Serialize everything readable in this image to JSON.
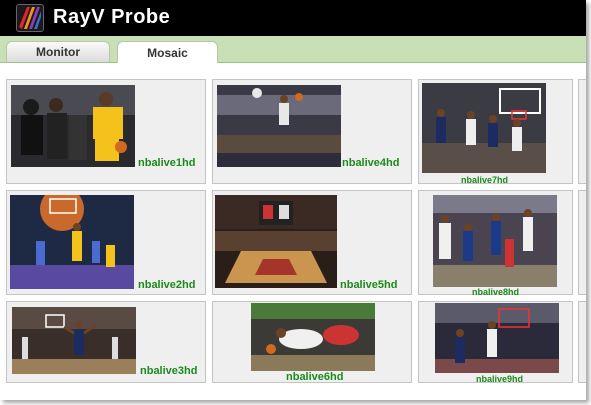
{
  "app": {
    "title": "RayV Probe"
  },
  "tabs": [
    {
      "label": "Monitor",
      "active": false
    },
    {
      "label": "Mosaic",
      "active": true
    }
  ],
  "channels": [
    {
      "name": "nbalive1hd"
    },
    {
      "name": "nbalive4hd"
    },
    {
      "name": "nbalive7hd"
    },
    {
      "name": "nbalive2hd"
    },
    {
      "name": "nbalive5hd"
    },
    {
      "name": "nbalive8hd"
    },
    {
      "name": "nbalive3hd"
    },
    {
      "name": "nbalive6hd"
    },
    {
      "name": "nbalive9hd"
    }
  ],
  "colors": {
    "label": "#1b8a1b",
    "tabbar": "#c9e0b7",
    "titlebar": "#000000"
  }
}
